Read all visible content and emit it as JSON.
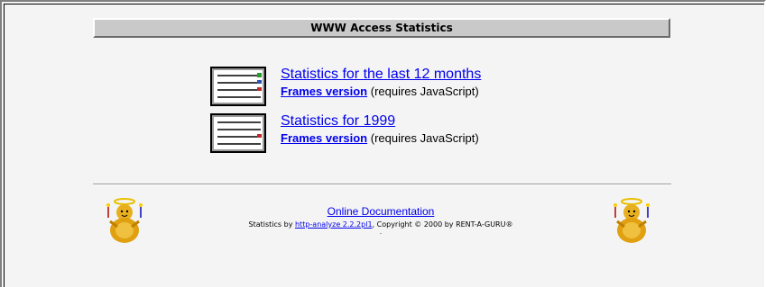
{
  "header": {
    "title": "WWW Access Statistics"
  },
  "stats": [
    {
      "title": "Statistics for the last 12 months",
      "frames_label": "Frames version",
      "note": "(requires JavaScript)"
    },
    {
      "title": "Statistics for 1999",
      "frames_label": "Frames version",
      "note": "(requires JavaScript)"
    }
  ],
  "footer": {
    "doc_link": "Online Documentation",
    "credits_prefix": "Statistics by ",
    "credits_link": "http-analyze 2.2.2pl1",
    "credits_suffix": ", Copyright © 2000 by RENT-A-GURU®",
    "dot": "."
  },
  "colors": {
    "link": "#0000ee",
    "title_bar": "#c9c9c9",
    "background": "#f4f4f4"
  },
  "icons": {
    "stats_icon": "stats-report-icon",
    "guru_icon": "rent-a-guru-mascot-icon"
  }
}
